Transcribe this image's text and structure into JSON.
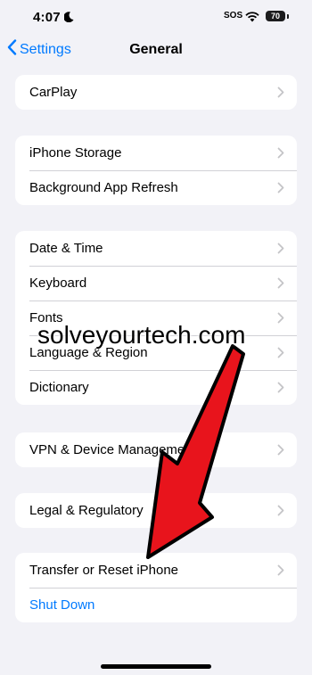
{
  "status_bar": {
    "time": "4:07",
    "sos": "SOS",
    "battery": "70"
  },
  "nav": {
    "back_label": "Settings",
    "title": "General"
  },
  "groups": [
    {
      "rows": [
        {
          "label": "CarPlay"
        }
      ]
    },
    {
      "rows": [
        {
          "label": "iPhone Storage"
        },
        {
          "label": "Background App Refresh"
        }
      ]
    },
    {
      "rows": [
        {
          "label": "Date & Time"
        },
        {
          "label": "Keyboard"
        },
        {
          "label": "Fonts"
        },
        {
          "label": "Language & Region"
        },
        {
          "label": "Dictionary"
        }
      ]
    },
    {
      "rows": [
        {
          "label": "VPN & Device Management"
        }
      ]
    },
    {
      "rows": [
        {
          "label": "Legal & Regulatory"
        }
      ]
    },
    {
      "rows": [
        {
          "label": "Transfer or Reset iPhone"
        },
        {
          "label": "Shut Down"
        }
      ]
    }
  ],
  "watermark": "solveyourtech.com",
  "colors": {
    "accent": "#007aff",
    "arrow": "#e8141c",
    "background": "#f2f2f7"
  }
}
